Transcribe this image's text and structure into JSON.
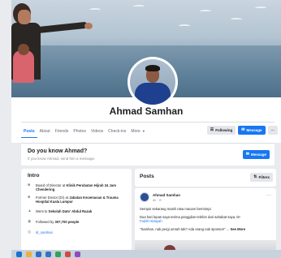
{
  "profile": {
    "name": "Ahmad Samhan"
  },
  "tabs": [
    {
      "label": "Posts",
      "active": true
    },
    {
      "label": "About"
    },
    {
      "label": "Friends"
    },
    {
      "label": "Photos"
    },
    {
      "label": "Videos"
    },
    {
      "label": "Check-ins"
    },
    {
      "label": "More"
    }
  ],
  "actions": {
    "following": "Following",
    "message": "Message",
    "more": "···"
  },
  "know": {
    "title": "Do you know Ahmad?",
    "subtitle": "If you know Ahmad, send him a message.",
    "message": "Message"
  },
  "intro": {
    "title": "Intro",
    "rows": [
      {
        "icon": "briefcase-icon",
        "pre": "Board of Director at ",
        "bold": "Klinik Perubatan Hijrah 24 Jam Chendering"
      },
      {
        "icon": "briefcase-icon",
        "pre": "Former Doctor (Dr) at ",
        "bold": "Jabatan Kecemasan & Trauma Hospital Kuala Lumpur"
      },
      {
        "icon": "graduation-icon",
        "pre": "Went to ",
        "bold": "Sekolah Dato' Abdul Razak"
      },
      {
        "icon": "followers-icon",
        "pre": "Followed by ",
        "bold": "307,700 people"
      },
      {
        "icon": "instagram-icon",
        "pre": "dr_samhan",
        "bold": ""
      }
    ]
  },
  "posts": {
    "title": "Posts",
    "filters": "Filters",
    "item": {
      "author": "Ahmad Samhan",
      "meta": "8h · ⊘",
      "line1": "Sempoi sekarang masih rasa macam bermimpi.",
      "line2": "Dua hari lepas saya terima panggilan telefon dari sahabat saya, Dr",
      "link": "Fadzil Hidayah",
      "line3": "\"Samhan, nak pergi umrah tak? Ada orang nak sponsor!\" ...",
      "see_more": "See More"
    }
  },
  "colors": {
    "accent": "#1877f2",
    "background": "#e9ebee"
  }
}
